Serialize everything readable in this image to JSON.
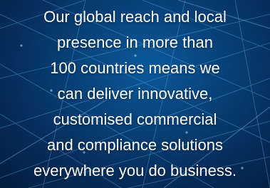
{
  "banner": {
    "lines": [
      "Our global reach and local",
      "presence in more than",
      "100 countries means we",
      "can deliver innovative,",
      "customised commercial",
      "and compliance solutions",
      "everywhere you do business."
    ]
  },
  "colors": {
    "background": "#08427a",
    "text": "#ffffff",
    "mesh_lines": "#5fb4f0"
  }
}
